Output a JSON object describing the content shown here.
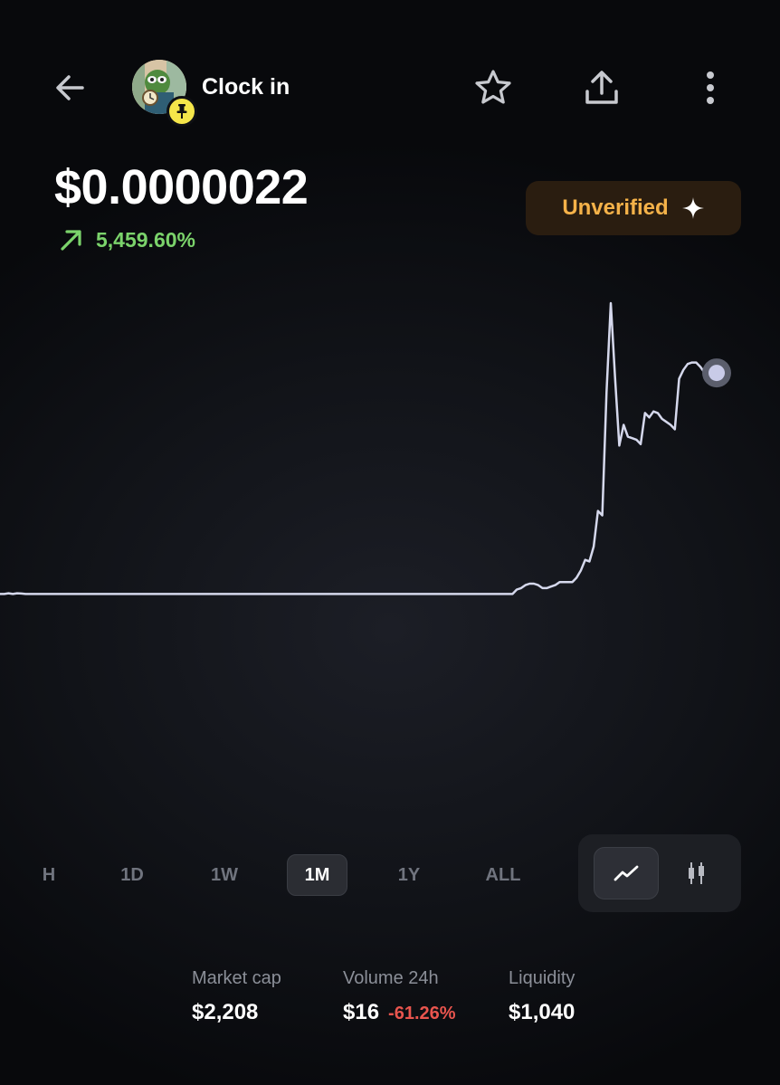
{
  "header": {
    "token_name": "Clock in",
    "back_icon": "arrow-left-icon",
    "favorite_icon": "star-icon",
    "share_icon": "share-icon",
    "more_icon": "more-vertical-icon",
    "avatar_badge_icon": "pin-icon"
  },
  "price": {
    "value": "$0.0000022",
    "change": "5,459.60%",
    "change_direction_icon": "arrow-up-right-icon",
    "change_color": "#7bd36b"
  },
  "badge": {
    "label": "Unverified",
    "icon": "sparkle-icon",
    "color": "#f5b249"
  },
  "timeframes": [
    "H",
    "1D",
    "1W",
    "1M",
    "1Y",
    "ALL"
  ],
  "active_timeframe": "1M",
  "chart_modes": {
    "line_icon": "line-chart-icon",
    "candle_icon": "candlestick-icon",
    "active": "line"
  },
  "stats": {
    "market_cap": {
      "label": "Market cap",
      "value": "$2,208"
    },
    "volume_24h": {
      "label": "Volume 24h",
      "value": "$16",
      "change": "-61.26%",
      "change_color": "#e9554e"
    },
    "liquidity": {
      "label": "Liquidity",
      "value": "$1,040"
    }
  },
  "chart_data": {
    "type": "line",
    "line_color": "#d5d8ec",
    "values": [
      0.04,
      0.04,
      0.045,
      0.04,
      0.045,
      0.043,
      0.04,
      0.04,
      0.04,
      0.04,
      0.04,
      0.04,
      0.04,
      0.04,
      0.04,
      0.04,
      0.04,
      0.04,
      0.04,
      0.04,
      0.04,
      0.04,
      0.04,
      0.04,
      0.04,
      0.04,
      0.04,
      0.04,
      0.04,
      0.04,
      0.04,
      0.04,
      0.04,
      0.04,
      0.04,
      0.04,
      0.04,
      0.04,
      0.04,
      0.04,
      0.04,
      0.04,
      0.04,
      0.04,
      0.04,
      0.04,
      0.04,
      0.04,
      0.04,
      0.04,
      0.04,
      0.04,
      0.04,
      0.04,
      0.04,
      0.04,
      0.04,
      0.04,
      0.04,
      0.04,
      0.04,
      0.04,
      0.04,
      0.04,
      0.04,
      0.04,
      0.04,
      0.04,
      0.04,
      0.04,
      0.04,
      0.04,
      0.04,
      0.04,
      0.04,
      0.04,
      0.04,
      0.04,
      0.04,
      0.04,
      0.04,
      0.04,
      0.04,
      0.04,
      0.04,
      0.04,
      0.04,
      0.04,
      0.04,
      0.04,
      0.04,
      0.04,
      0.04,
      0.04,
      0.04,
      0.04,
      0.04,
      0.04,
      0.04,
      0.04,
      0.04,
      0.04,
      0.04,
      0.04,
      0.04,
      0.04,
      0.04,
      0.04,
      0.04,
      0.04,
      0.04,
      0.04,
      0.04,
      0.04,
      0.04,
      0.04,
      0.04,
      0.04,
      0.04,
      0.04,
      0.04,
      0.07,
      0.08,
      0.1,
      0.11,
      0.11,
      0.1,
      0.08,
      0.08,
      0.09,
      0.1,
      0.12,
      0.12,
      0.12,
      0.12,
      0.15,
      0.2,
      0.27,
      0.26,
      0.36,
      0.6,
      0.57,
      1.4,
      2.0,
      1.5,
      1.04,
      1.18,
      1.1,
      1.09,
      1.08,
      1.05,
      1.26,
      1.23,
      1.27,
      1.26,
      1.22,
      1.2,
      1.18,
      1.15,
      1.49,
      1.55,
      1.59,
      1.6,
      1.6,
      1.57,
      1.53,
      1.53,
      1.53,
      1.53
    ],
    "ylim": [
      0,
      2.0
    ]
  }
}
